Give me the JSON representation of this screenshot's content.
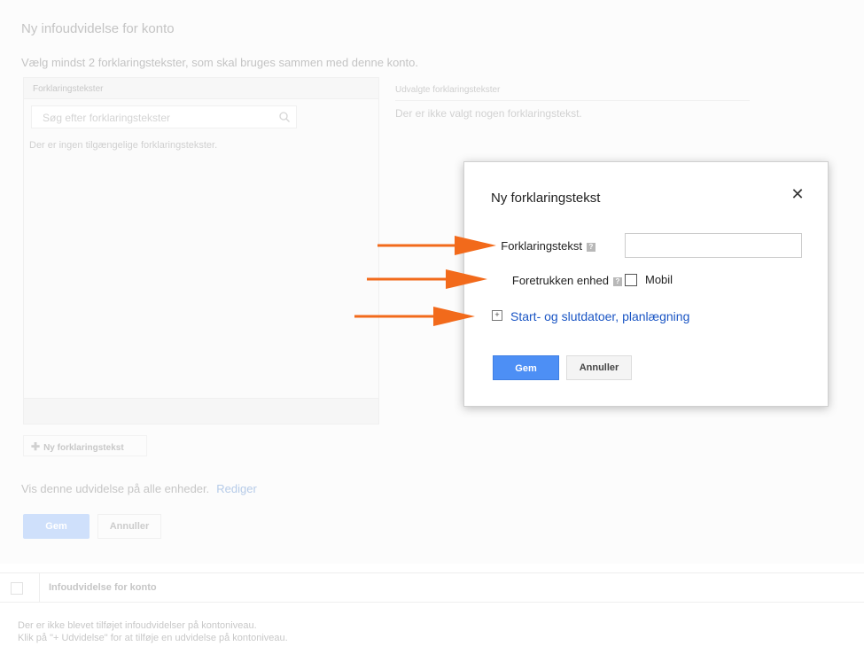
{
  "page": {
    "title": "Ny infoudvidelse for konto",
    "instruction": "Vælg mindst 2 forklaringstekster, som skal bruges sammen med denne konto."
  },
  "left_panel": {
    "header": "Forklaringstekster",
    "search_placeholder": "Søg efter forklaringstekster",
    "empty_text": "Der er ingen tilgængelige forklaringstekster."
  },
  "right_panel": {
    "header": "Udvalgte forklaringstekster",
    "empty_text": "Der er ikke valgt nogen forklaringstekst."
  },
  "new_button": {
    "label": "Ny forklaringstekst"
  },
  "visibility": {
    "text": "Vis denne udvidelse på alle enheder.",
    "link": "Rediger"
  },
  "bg_buttons": {
    "save": "Gem",
    "cancel": "Annuller"
  },
  "table": {
    "column": "Infoudvidelse for konto"
  },
  "empty_message": {
    "line1": "Der er ikke blevet tilføjet infoudvidelser på kontoniveau.",
    "line2": "Klik på \"+ Udvidelse\" for at tilføje en udvidelse på kontoniveau."
  },
  "dialog": {
    "title": "Ny forklaringstekst",
    "close": "✕",
    "field_label": "Forklaringstekst",
    "help_glyph": "?",
    "field_value": "",
    "device_label": "Foretrukken enhed",
    "device_option": "Mobil",
    "device_checked": false,
    "expand_glyph": "+",
    "expand_link": "Start- og slutdatoer, planlægning",
    "save": "Gem",
    "cancel": "Annuller"
  },
  "colors": {
    "accent": "#4d8ff5",
    "link": "#1a55c4",
    "arrow": "#f26a1b"
  }
}
